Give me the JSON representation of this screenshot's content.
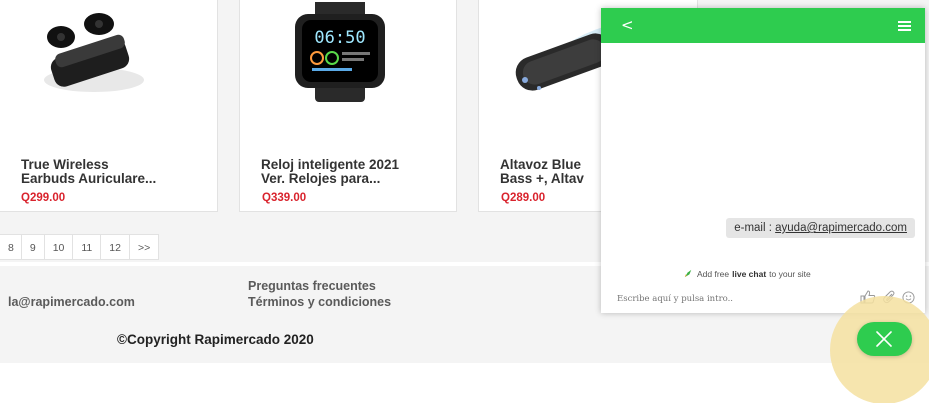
{
  "products": [
    {
      "title": "True Wireless\nEarbuds Auriculare...",
      "price": "Q299.00",
      "image_icon": "earbuds-icon"
    },
    {
      "title": "Reloj inteligente 2021\nVer. Relojes para...",
      "price": "Q339.00",
      "image_icon": "smartwatch-icon",
      "watch_time": "06:50"
    },
    {
      "title": "Altavoz Blue\nBass +, Altav",
      "price": "Q289.00",
      "image_icon": "speaker-icon"
    }
  ],
  "pagination": [
    "8",
    "9",
    "10",
    "11",
    "12",
    ">>"
  ],
  "footer": {
    "email": "la@rapimercado.com",
    "links": [
      "Preguntas frecuentes",
      "Términos y condiciones"
    ],
    "copyright": "©Copyright Rapimercado 2020"
  },
  "chat": {
    "back": "<",
    "message_prefix": "e-mail : ",
    "message_link": "ayuda@rapimercado.com",
    "promo_prefix": "Add free ",
    "promo_bold": "live chat",
    "promo_suffix": " to your site",
    "input_placeholder": "Escribe aquí y pulsa intro..",
    "colors": {
      "header": "#2ecc4f"
    }
  },
  "colors": {
    "price": "#d9232d",
    "accent": "#2ecc4f"
  }
}
